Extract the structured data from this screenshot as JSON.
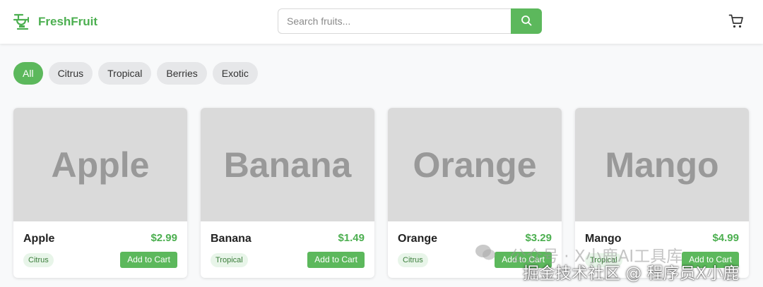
{
  "header": {
    "brand": "FreshFruit",
    "search_placeholder": "Search fruits...",
    "search_value": "",
    "brand_color": "#4caf50",
    "accent_color": "#5cb85c"
  },
  "filters": [
    {
      "label": "All",
      "active": true
    },
    {
      "label": "Citrus",
      "active": false
    },
    {
      "label": "Tropical",
      "active": false
    },
    {
      "label": "Berries",
      "active": false
    },
    {
      "label": "Exotic",
      "active": false
    }
  ],
  "products": [
    {
      "image_text": "Apple",
      "name": "Apple",
      "price": "$2.99",
      "tag": "Citrus",
      "button": "Add to Cart"
    },
    {
      "image_text": "Banana",
      "name": "Banana",
      "price": "$1.49",
      "tag": "Tropical",
      "button": "Add to Cart"
    },
    {
      "image_text": "Orange",
      "name": "Orange",
      "price": "$3.29",
      "tag": "Citrus",
      "button": "Add to Cart"
    },
    {
      "image_text": "Mango",
      "name": "Mango",
      "price": "$4.99",
      "tag": "Tropical",
      "button": "Add to Cart"
    }
  ],
  "watermark": {
    "line1": "公众号 · X小鹿AI工具库",
    "line2": "掘金技术社区 @ 程序员X小鹿"
  }
}
